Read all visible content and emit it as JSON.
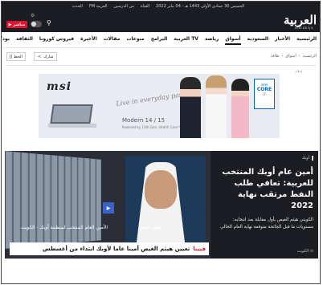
{
  "header": {
    "utility_links": [
      "الخميس 30 جمادى الأولى 1443 هـ - 04 يناير 2022",
      "القناة",
      "من الدرسين",
      "العربية FM",
      "الحدث"
    ],
    "logo": "العربية",
    "logo_sub": "alarabiya",
    "live_label": "مباشر",
    "live_icon": "play-icon"
  },
  "nav": {
    "items": [
      "الرئيسية",
      "الأخبار",
      "السعودية",
      "أسواق",
      "رياضة",
      "العربية TV",
      "البرامج",
      "منوعات",
      "مقالات",
      "الأخيرة",
      "فيروس كورونا",
      "الثقافة",
      "بودكاست"
    ],
    "active_index": 3
  },
  "breadcrumb": [
    "الرئيسية",
    "أسواق",
    "طاقة"
  ],
  "share_label": "شارك",
  "font_label": "الخط",
  "ad": {
    "label": "إعلان",
    "brand": "msi",
    "tagline": "Live in everyday passion",
    "model": "Modern 14 / 15",
    "powered": "Powered by 11th Gen. Intel® Core™ i7 processor",
    "badge_brand": "intel",
    "badge_line1": "CORE",
    "badge_line2": "i7"
  },
  "hero": {
    "tag": "أوبك",
    "title": "أمين عام أوبك المنتخب للعربية: تعافي طلب النفط مرتقب نهاية 2022",
    "lede": "الكويتي هيثم الغيص بأول مقابلة بعد انتخابه: مستويات ما قبل الجائحة متوقعة نهاية العام الحالي",
    "place": "الكويت",
    "caption_building": "الأمين العام المنتخب لمنظمة أوبك - الكويت",
    "person_name": "هيثم الغيص",
    "ticker_tag": "فيينا",
    "ticker_text": "تعيين هيثم الغيص أمينا عاما لأوبك ابتداء من أغسطس"
  }
}
